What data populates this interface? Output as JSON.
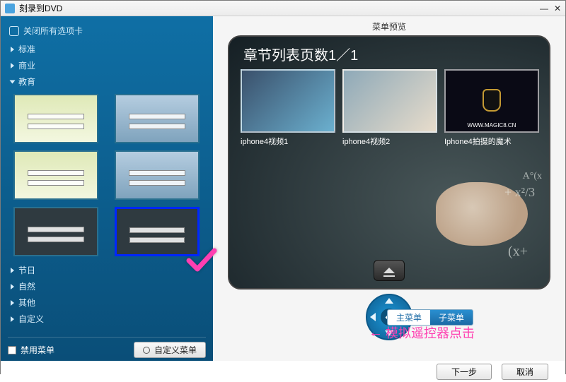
{
  "window": {
    "title": "刻录到DVD"
  },
  "sidebar": {
    "close_all": "关闭所有选项卡",
    "items": [
      {
        "label": "标准",
        "expanded": false
      },
      {
        "label": "商业",
        "expanded": false
      },
      {
        "label": "教育",
        "expanded": true
      },
      {
        "label": "节日",
        "expanded": false
      },
      {
        "label": "自然",
        "expanded": false
      },
      {
        "label": "其他",
        "expanded": false
      },
      {
        "label": "自定义",
        "expanded": false
      }
    ],
    "disable_menu": "禁用菜单",
    "custom_menu_btn": "自定义菜单"
  },
  "preview": {
    "panel_title": "菜单预览",
    "chapter_heading": "章节列表页数1／1",
    "chapters": [
      {
        "caption": "iphone4视频1"
      },
      {
        "caption": "iphone4视频2"
      },
      {
        "caption": "Iphone4拍摄的魔术",
        "url": "WWW.MAGIC8.CN"
      }
    ],
    "tabs": {
      "main": "主菜单",
      "sub": "子菜单"
    },
    "annotation": "模拟遥控器点击"
  },
  "footer": {
    "next": "下一步",
    "cancel": "取消"
  }
}
